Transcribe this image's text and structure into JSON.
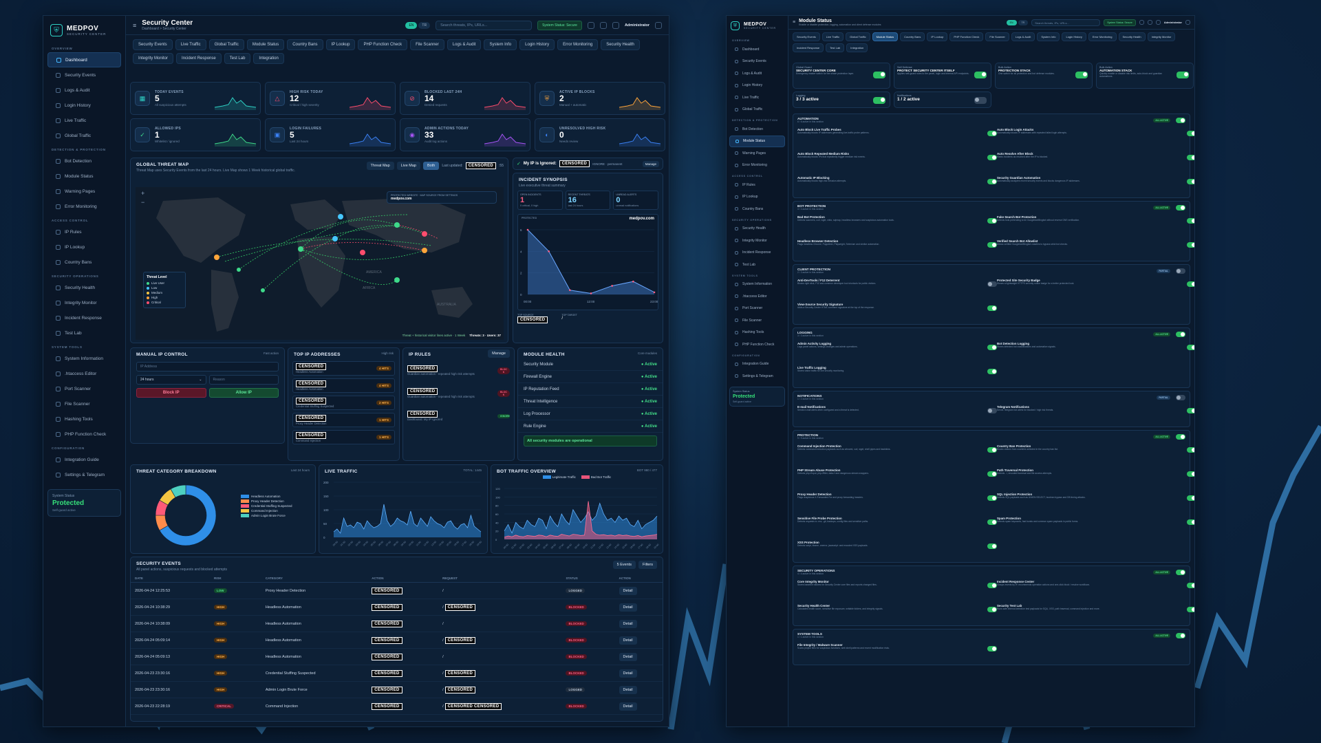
{
  "brand": {
    "name": "MEDPOV",
    "sub": "SECURITY CENTER"
  },
  "sidebar": {
    "sections": [
      {
        "title": "OVERVIEW",
        "items": [
          "Dashboard",
          "Security Events",
          "Logs & Audit",
          "Login History",
          "Live Traffic",
          "Global Traffic"
        ]
      },
      {
        "title": "DETECTION & PROTECTION",
        "items": [
          "Bot Detection",
          "Module Status",
          "Warning Pages",
          "Error Monitoring"
        ]
      },
      {
        "title": "ACCESS CONTROL",
        "items": [
          "IP Rules",
          "IP Lookup",
          "Country Bans"
        ]
      },
      {
        "title": "SECURITY OPERATIONS",
        "items": [
          "Security Health",
          "Integrity Monitor",
          "Incident Response",
          "Test Lab"
        ]
      },
      {
        "title": "SYSTEM TOOLS",
        "items": [
          "System Information",
          ".htaccess Editor",
          "Port Scanner",
          "File Scanner",
          "Hashing Tools",
          "PHP Function Check"
        ]
      },
      {
        "title": "CONFIGURATION",
        "items": [
          "Integration Guide",
          "Settings & Telegram"
        ]
      }
    ],
    "status": {
      "label": "System Status",
      "value": "Protected",
      "sub": "Self-guard active"
    }
  },
  "topbar": {
    "title": "Security Center",
    "crumb": "Dashboard > Security Center",
    "lang1": "EN",
    "lang2": "TR",
    "search_placeholder": "Search threats, IPs, URLs...",
    "status": "System Status: Secure",
    "user": "Administrator"
  },
  "tabs": [
    "Security Events",
    "Live Traffic",
    "Global Traffic",
    "Module Status",
    "Country Bans",
    "IP Lookup",
    "PHP Function Check",
    "File Scanner",
    "Logs & Audit",
    "System Info",
    "Login History",
    "Error Monitoring",
    "Security Health",
    "Integrity Monitor",
    "Incident Response",
    "Test Lab",
    "Integration"
  ],
  "stats": [
    {
      "label": "TODAY EVENTS",
      "value": "5",
      "sub": "All suspicious attempts",
      "color": "#2fd3c6",
      "icon": "calendar-icon"
    },
    {
      "label": "HIGH RISK TODAY",
      "value": "12",
      "sub": "Critical / high severity",
      "color": "#ff4d6d",
      "icon": "warning-icon"
    },
    {
      "label": "BLOCKED LAST 24H",
      "value": "14",
      "sub": "Denied requests",
      "color": "#ff4d6d",
      "icon": "block-icon"
    },
    {
      "label": "ACTIVE IP BLOCKS",
      "value": "2",
      "sub": "Manual + automatic",
      "color": "#ffa53b",
      "icon": "shield-icon"
    },
    {
      "label": "ALLOWED IPS",
      "value": "1",
      "sub": "Whitelist / ignored",
      "color": "#3ed98a",
      "icon": "check-icon"
    },
    {
      "label": "LOGIN FAILURES",
      "value": "5",
      "sub": "Last 24 hours",
      "color": "#3b82f6",
      "icon": "lock-icon"
    },
    {
      "label": "ADMIN ACTIONS TODAY",
      "value": "33",
      "sub": "Audit log actions",
      "color": "#a855f7",
      "icon": "user-icon"
    },
    {
      "label": "UNRESOLVED HIGH RISK",
      "value": "0",
      "sub": "Needs review",
      "color": "#3b82f6",
      "icon": "alert-icon"
    }
  ],
  "map": {
    "title": "GLOBAL THREAT MAP",
    "sub": "Threat Map uses Security Events from the last 24 hours. Live Map shows 1 Week historical global traffic.",
    "btn1": "Threat Map",
    "btn2": "Live Map",
    "btn3": "Both",
    "updated": "Last updated:",
    "censored": "CENSORED",
    "updated_tail": ":55",
    "protected_label": "PROTECTED WEBSITE · MAP SOURCE FROM SETTINGS",
    "protected_site": "medpov.com",
    "legend_title": "Threat Level",
    "legend": [
      "Live User",
      "Low",
      "Medium",
      "High",
      "Critical"
    ],
    "footer": "Threat + historical visitor lines active · 1 Week",
    "threats": "Threats: 3 · Users: 37",
    "continent1": "AMERICA",
    "continent2": "AFRICA",
    "continent3": "AUSTRALIA"
  },
  "ignored": {
    "label": "My IP is Ignored:",
    "value": "CENSORED",
    "mode": "IGNORE · permanent",
    "btn": "Manage"
  },
  "synopsis": {
    "title": "INCIDENT SYNOPSIS",
    "sub": "Live executive threat summary",
    "k1": "OPEN INCIDENTS",
    "v1": "1",
    "s1": "0 critical, 0 high",
    "k2": "RECENT THREATS",
    "v2": "16",
    "s2": "last 24 hours",
    "k3": "UNREAD ALERTS",
    "v3": "0",
    "s3": "unread notifications",
    "protector": "PROTECTED",
    "site": "medpov.com",
    "xticks": [
      "00:00",
      "12:00",
      "23:00"
    ],
    "yticks": [
      "6",
      "4",
      "2",
      "0"
    ],
    "top_source": "TOP SOURCE",
    "top_target": "TOP TARGET",
    "top_target_val": "/",
    "series": [
      6,
      4,
      0.4,
      0.1,
      0.8,
      1.2,
      0.2
    ]
  },
  "manual": {
    "title": "MANUAL IP CONTROL",
    "tag": "Fast action",
    "ip_placeholder": "IP Address",
    "duration": "24 hours",
    "reason_placeholder": "Reason",
    "block": "Block IP",
    "allow": "Allow IP"
  },
  "topip": {
    "title": "TOP IP ADDRESSES",
    "tag": "High risk",
    "rows": [
      {
        "ip": "CENSORED",
        "cat": "Headless Automation",
        "n": "4 HITS"
      },
      {
        "ip": "CENSORED",
        "cat": "Headless Automation",
        "n": "4 HITS"
      },
      {
        "ip": "CENSORED",
        "cat": "Credential Stuffing Suspected",
        "n": "2 HITS"
      },
      {
        "ip": "CENSORED",
        "cat": "Proxy Header Detection",
        "n": "1 HITS"
      },
      {
        "ip": "CENSORED",
        "cat": "Command Injection",
        "n": "1 HITS"
      }
    ]
  },
  "iprules": {
    "title": "IP RULES",
    "btn": "Manage",
    "rows": [
      {
        "ip": "CENSORED",
        "d": "Guardian automation - repeated high risk attempts",
        "b": "BLOC K"
      },
      {
        "ip": "CENSORED",
        "d": "Guardian automation - repeated high risk attempts",
        "b": "BLOC K"
      },
      {
        "ip": "CENSORED",
        "d": "Dashboard: My IP Ignored",
        "b": "IGNORE"
      }
    ]
  },
  "health": {
    "title": "MODULE HEALTH",
    "tag": "Core modules",
    "rows": [
      {
        "n": "Security Module",
        "s": "Active"
      },
      {
        "n": "Firewall Engine",
        "s": "Active"
      },
      {
        "n": "IP Reputation Feed",
        "s": "Active"
      },
      {
        "n": "Threat Intelligence",
        "s": "Active"
      },
      {
        "n": "Log Processor",
        "s": "Active"
      },
      {
        "n": "Rule Engine",
        "s": "Active"
      }
    ],
    "ok": "All security modules are operational"
  },
  "breakdown": {
    "title": "THREAT CATEGORY BREAKDOWN",
    "tag": "Last 24 hours",
    "items": [
      {
        "n": "Headless Automation",
        "v": 8,
        "c": "#2f8fe8"
      },
      {
        "n": "Proxy Header Detection",
        "v": 1,
        "c": "#ff8c4b"
      },
      {
        "n": "Credential Stuffing Suspected",
        "v": 1,
        "c": "#ff5a78"
      },
      {
        "n": "Command Injection",
        "v": 1,
        "c": "#f4c542"
      },
      {
        "n": "Admin Login Brute Force",
        "v": 1,
        "c": "#4ed0c0"
      }
    ]
  },
  "live": {
    "title": "LIVE TRAFFIC",
    "tag": "TOTAL: 1445",
    "yticks": [
      "200",
      "150",
      "100",
      "50",
      "0"
    ],
    "series": [
      20,
      30,
      15,
      70,
      40,
      45,
      35,
      55,
      50,
      30,
      60,
      45,
      35,
      40,
      50,
      120,
      60,
      40,
      50,
      70,
      60,
      55,
      45,
      95,
      50,
      40,
      70,
      55,
      40,
      75,
      60,
      50,
      45,
      35,
      55,
      60,
      40,
      30,
      45,
      50,
      35,
      80,
      40,
      30,
      20
    ]
  },
  "bot": {
    "title": "BOT TRAFFIC OVERVIEW",
    "tag": "BOT 980 / 477",
    "leg1": "Legitimate Traffic",
    "leg2": "Bad Bot Traffic",
    "yticks": [
      "120",
      "100",
      "80",
      "60",
      "40",
      "20",
      "0"
    ],
    "legit": [
      20,
      35,
      15,
      40,
      30,
      25,
      45,
      35,
      30,
      50,
      45,
      25,
      55,
      40,
      30,
      60,
      45,
      35,
      70,
      55,
      40,
      50,
      65,
      45,
      55,
      85,
      60,
      45,
      50,
      40,
      55,
      45,
      50,
      35,
      30,
      45,
      25,
      35,
      40,
      45,
      55
    ],
    "bad": [
      5,
      8,
      6,
      10,
      7,
      6,
      9,
      8,
      7,
      10,
      9,
      6,
      10,
      8,
      7,
      12,
      10,
      8,
      12,
      11,
      9,
      10,
      90,
      20,
      12,
      10,
      11,
      9,
      10,
      8,
      11,
      9,
      10,
      8,
      7,
      9,
      6,
      8,
      9,
      10,
      12
    ]
  },
  "events": {
    "title": "SECURITY EVENTS",
    "sub": "All panel actions, suspicious requests and blocked attempts",
    "count": "5 Events",
    "filters": "Filters",
    "cols": [
      "DATE",
      "RISK",
      "CATEGORY",
      "ACTION",
      "REQUEST",
      "STATUS",
      "ACTION"
    ],
    "rows": [
      {
        "date": "2026-04-24 12:25:53",
        "risk": "LOW",
        "cat": "Proxy Header Detection",
        "act": "CENSORED",
        "req": "/",
        "reqc": "",
        "status": "LOGGED",
        "btn": "Detail"
      },
      {
        "date": "2026-04-24 10:38:29",
        "risk": "HIGH",
        "cat": "Headless Automation",
        "act": "CENSORED",
        "req": "/",
        "reqc": "CENSORED",
        "status": "BLOCKED",
        "btn": "Detail"
      },
      {
        "date": "2026-04-24 10:38:09",
        "risk": "HIGH",
        "cat": "Headless Automation",
        "act": "CENSORED",
        "req": "/",
        "reqc": "",
        "status": "BLOCKED",
        "btn": "Detail"
      },
      {
        "date": "2026-04-24 05:09:14",
        "risk": "HIGH",
        "cat": "Headless Automation",
        "act": "CENSORED",
        "req": "/",
        "reqc": "CENSORED",
        "status": "BLOCKED",
        "btn": "Detail"
      },
      {
        "date": "2026-04-24 05:09:13",
        "risk": "HIGH",
        "cat": "Headless Automation",
        "act": "CENSORED",
        "req": "/",
        "reqc": "",
        "status": "BLOCKED",
        "btn": "Detail"
      },
      {
        "date": "2026-04-23 23:30:16",
        "risk": "HIGH",
        "cat": "Credential Stuffing Suspected",
        "act": "CENSORED",
        "req": "/",
        "reqc": "CENSORED",
        "status": "BLOCKED",
        "btn": "Detail"
      },
      {
        "date": "2026-04-23 23:30:16",
        "risk": "HIGH",
        "cat": "Admin Login Brute Force",
        "act": "CENSORED",
        "req": "/",
        "reqc": "CENSORED",
        "status": "LOGGED",
        "btn": "Detail"
      },
      {
        "date": "2026-04-23 22:28:19",
        "risk": "CRITICAL",
        "cat": "Command Injection",
        "act": "CENSORED",
        "req": "/",
        "reqc": "CENSORED CENSORED",
        "status": "BLOCKED",
        "btn": "Detail"
      }
    ]
  },
  "module": {
    "title": "Module Status",
    "sub": "Enable or disable protection, logging, automation and client defense modules",
    "user": "Administrator",
    "status": "System Status: Secure",
    "search": "Search threats, IPs, URLs...",
    "tops": [
      {
        "k": "Global Guard",
        "t": "SECURITY CENTER CORE",
        "d": "Emergency master switch for the whole protection layer."
      },
      {
        "k": "Self Defense",
        "t": "PROTECT SECURITY CENTER ITSELF",
        "d": "Applies self-guard rules to the panel, login and internal API endpoints."
      },
      {
        "k": "Bulk Action",
        "t": "PROTECTION STACK",
        "d": "One switch for all protection and bot defense modules."
      },
      {
        "k": "Bulk Action",
        "t": "AUTOMATION STACK",
        "d": "Quickly enable or disable risk limits, auto-block and guardian automations."
      }
    ],
    "logging": {
      "k": "Logging",
      "v": "3 / 3 active"
    },
    "notif": {
      "k": "Notifications",
      "v": "1 / 2 active"
    },
    "groups": [
      {
        "t": "AUTOMATION",
        "s": "6 / 6 active in this section",
        "b": "ALL ACTIVE",
        "feats": [
          [
            "Auto Block Live Traffic Probes",
            "Automatically blocks IP addresses generating live-traffic probe patterns.",
            1
          ],
          [
            "Auto Block Login Attacks",
            "Automatically blocks IP addresses with repeated failed login attempts.",
            1
          ],
          [
            "Auto Block Repeated Medium Risks",
            "Automatically blocks IPs that repeatedly trigger medium risk events.",
            1
          ],
          [
            "Auto Resolve After Block",
            "Marks incidents as resolved after the IP is blocked.",
            1
          ],
          [
            "Automatic IP Blocking",
            "Automatically blocks high-risk intrusion attempts.",
            1
          ],
          [
            "Security Guardian Automation",
            "Automatically analyzes recent security events and blocks dangerous IP addresses.",
            1
          ]
        ]
      },
      {
        "t": "BOT PROTECTION",
        "s": "4 / 4 active in this section",
        "b": "ALL ACTIVE",
        "feats": [
          [
            "Bad Bot Protection",
            "Detects scanners, curl, wget, nikto, sqlmap, headless browsers and suspicious automation tools.",
            1
          ],
          [
            "Fake Search Bot Protection",
            "Detects bots pretending to be Googlebot/Bingbot without reverse DNS verification.",
            1
          ],
          [
            "Headless Browser Detection",
            "Flags headless Chrome, Puppeteer, Playwright, Selenium and similar automation.",
            1
          ],
          [
            "Verified Search Bot Allowlist",
            "Allows verified Googlebot/Bingbot crawlers to bypass strict bot checks.",
            1
          ]
        ]
      },
      {
        "t": "CLIENT PROTECTION",
        "s": "2 / 3 active in this section",
        "b": "PARTIAL",
        "feats": [
          [
            "Anti-DevTools / F12 Deterrent",
            "Blocks right click, F12 and common developer tool shortcuts for public visitors.",
            0
          ],
          [
            "Protected Site Security Badge",
            "Shows a lightweight HTTPS security notice badge for a better protected look.",
            1
          ],
          [
            "View-Source Security Signature",
            "Adds a Security Center HTML comment signature at the top of the response.",
            1
          ]
        ]
      },
      {
        "t": "LOGGING",
        "s": "3 / 3 active in this section",
        "b": "ALL ACTIVE",
        "feats": [
          [
            "Admin Activity Logging",
            "Logs panel actions, settings changes and admin operations.",
            1
          ],
          [
            "Bot Detection Logging",
            "Stores detected bot classifications and automation signals.",
            1
          ],
          [
            "Live Traffic Logging",
            "Stores visitor traffic for live security monitoring.",
            1
          ]
        ]
      },
      {
        "t": "NOTIFICATIONS",
        "s": "1 / 2 active in this section",
        "b": "PARTIAL",
        "feats": [
          [
            "E-mail Notifications",
            "Sends e-mail alerts when configured and a threat is detected.",
            0
          ],
          [
            "Telegram Notifications",
            "Sends Telegram bot alerts for blocked / high risk threats.",
            1
          ]
        ]
      },
      {
        "t": "PROTECTION",
        "s": "9 / 9 active in this section",
        "b": "ALL ACTIVE",
        "feats": [
          [
            "Command Injection Protection",
            "Detects command execution payloads such as whoami, curl, wget, shell pipes and backticks.",
            1
          ],
          [
            "Country Ban Protection",
            "Blocks visitors from countries selected in the country ban list.",
            1
          ],
          [
            "PHP Stream Abuse Protection",
            "Detects php://input, php://filter, data:// and dangerous stream wrappers.",
            1
          ],
          [
            "Path Traversal Protection",
            "Detects ../, encoded traversal and file access attempts.",
            1
          ],
          [
            "Proxy Header Detection",
            "Flags suspicious X-Forwarded-For and proxy forwarding headers.",
            1
          ],
          [
            "SQL Injection Protection",
            "Detects SQL payloads such as UNION SELECT, boolean bypass and DB timing attacks.",
            1
          ],
          [
            "Sensitive File Probe Protection",
            "Detects requests to .env, .git, backups, config files and sensitive paths.",
            1
          ],
          [
            "Spam Protection",
            "Detects spam keywords, fast bursts and common spam payloads in public forms.",
            1
          ],
          [
            "XSS Protection",
            "Detects script, iframe, onerror, javascript: and encoded XSS payloads.",
            1
          ]
        ]
      },
      {
        "t": "SECURITY OPERATIONS",
        "s": "4 / 4 active in this section",
        "b": "ALL ACTIVE",
        "feats": [
          [
            "Core Integrity Monitor",
            "Stores baseline hashes for Security Center core files and reports changed files.",
            1
          ],
          [
            "Incident Response Center",
            "Groups events by IP, recommends operation actions and one-click block / resolve workflows.",
            1
          ],
          [
            "Security Health Center",
            "Calculates health score, sensitive file exposure, writable folders, and integrity signals.",
            1
          ],
          [
            "Security Test Lab",
            "Runs safe internal detection test payloads for SQLi, XSS, path traversal, command injection and more.",
            1
          ]
        ]
      },
      {
        "t": "SYSTEM TOOLS",
        "s": "1 / 1 active in this section",
        "b": "ALL ACTIVE",
        "feats": [
          [
            "File Integrity / Malware Scanner",
            "Scans project files for suspicious functions, web shell patterns and recent modification risks.",
            1
          ]
        ]
      }
    ]
  }
}
